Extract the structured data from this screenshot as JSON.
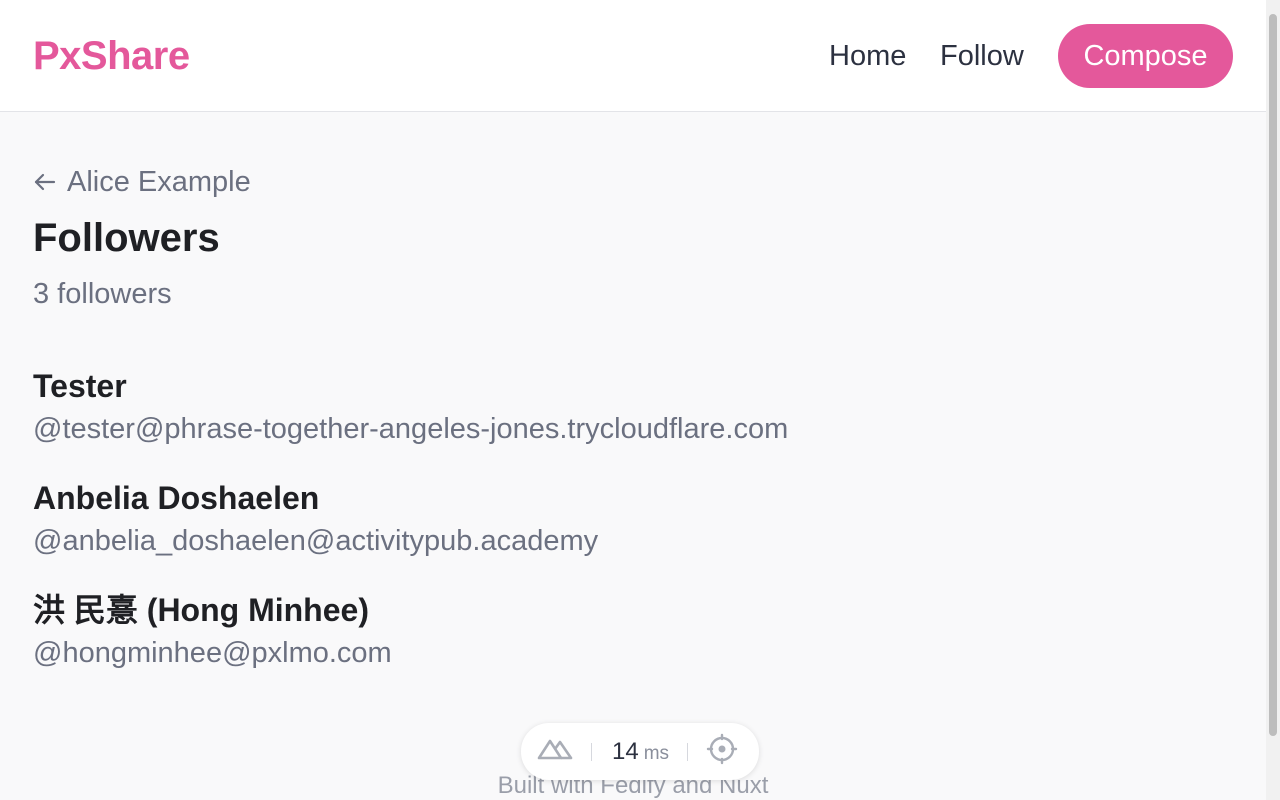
{
  "header": {
    "logo": "PxShare",
    "nav": {
      "home": "Home",
      "follow": "Follow"
    },
    "compose_label": "Compose"
  },
  "main": {
    "back_label": "Alice Example",
    "title": "Followers",
    "count_text": "3 followers",
    "followers": [
      {
        "name": "Tester",
        "handle": "@tester@phrase-together-angeles-jones.trycloudflare.com"
      },
      {
        "name": "Anbelia Doshaelen",
        "handle": "@anbelia_doshaelen@activitypub.academy"
      },
      {
        "name": "洪 民憙 (Hong Minhee)",
        "handle": "@hongminhee@pxlmo.com"
      }
    ]
  },
  "devbar": {
    "time_value": "14",
    "time_unit": "ms",
    "icons": [
      "nuxt-icon",
      "crosshair-icon"
    ]
  },
  "footer": {
    "text": "Built with Fedify and Nuxt"
  },
  "colors": {
    "brand": "#e4589b",
    "text": "#1f2024",
    "muted": "#6b7080",
    "background": "#f9f9fa"
  }
}
